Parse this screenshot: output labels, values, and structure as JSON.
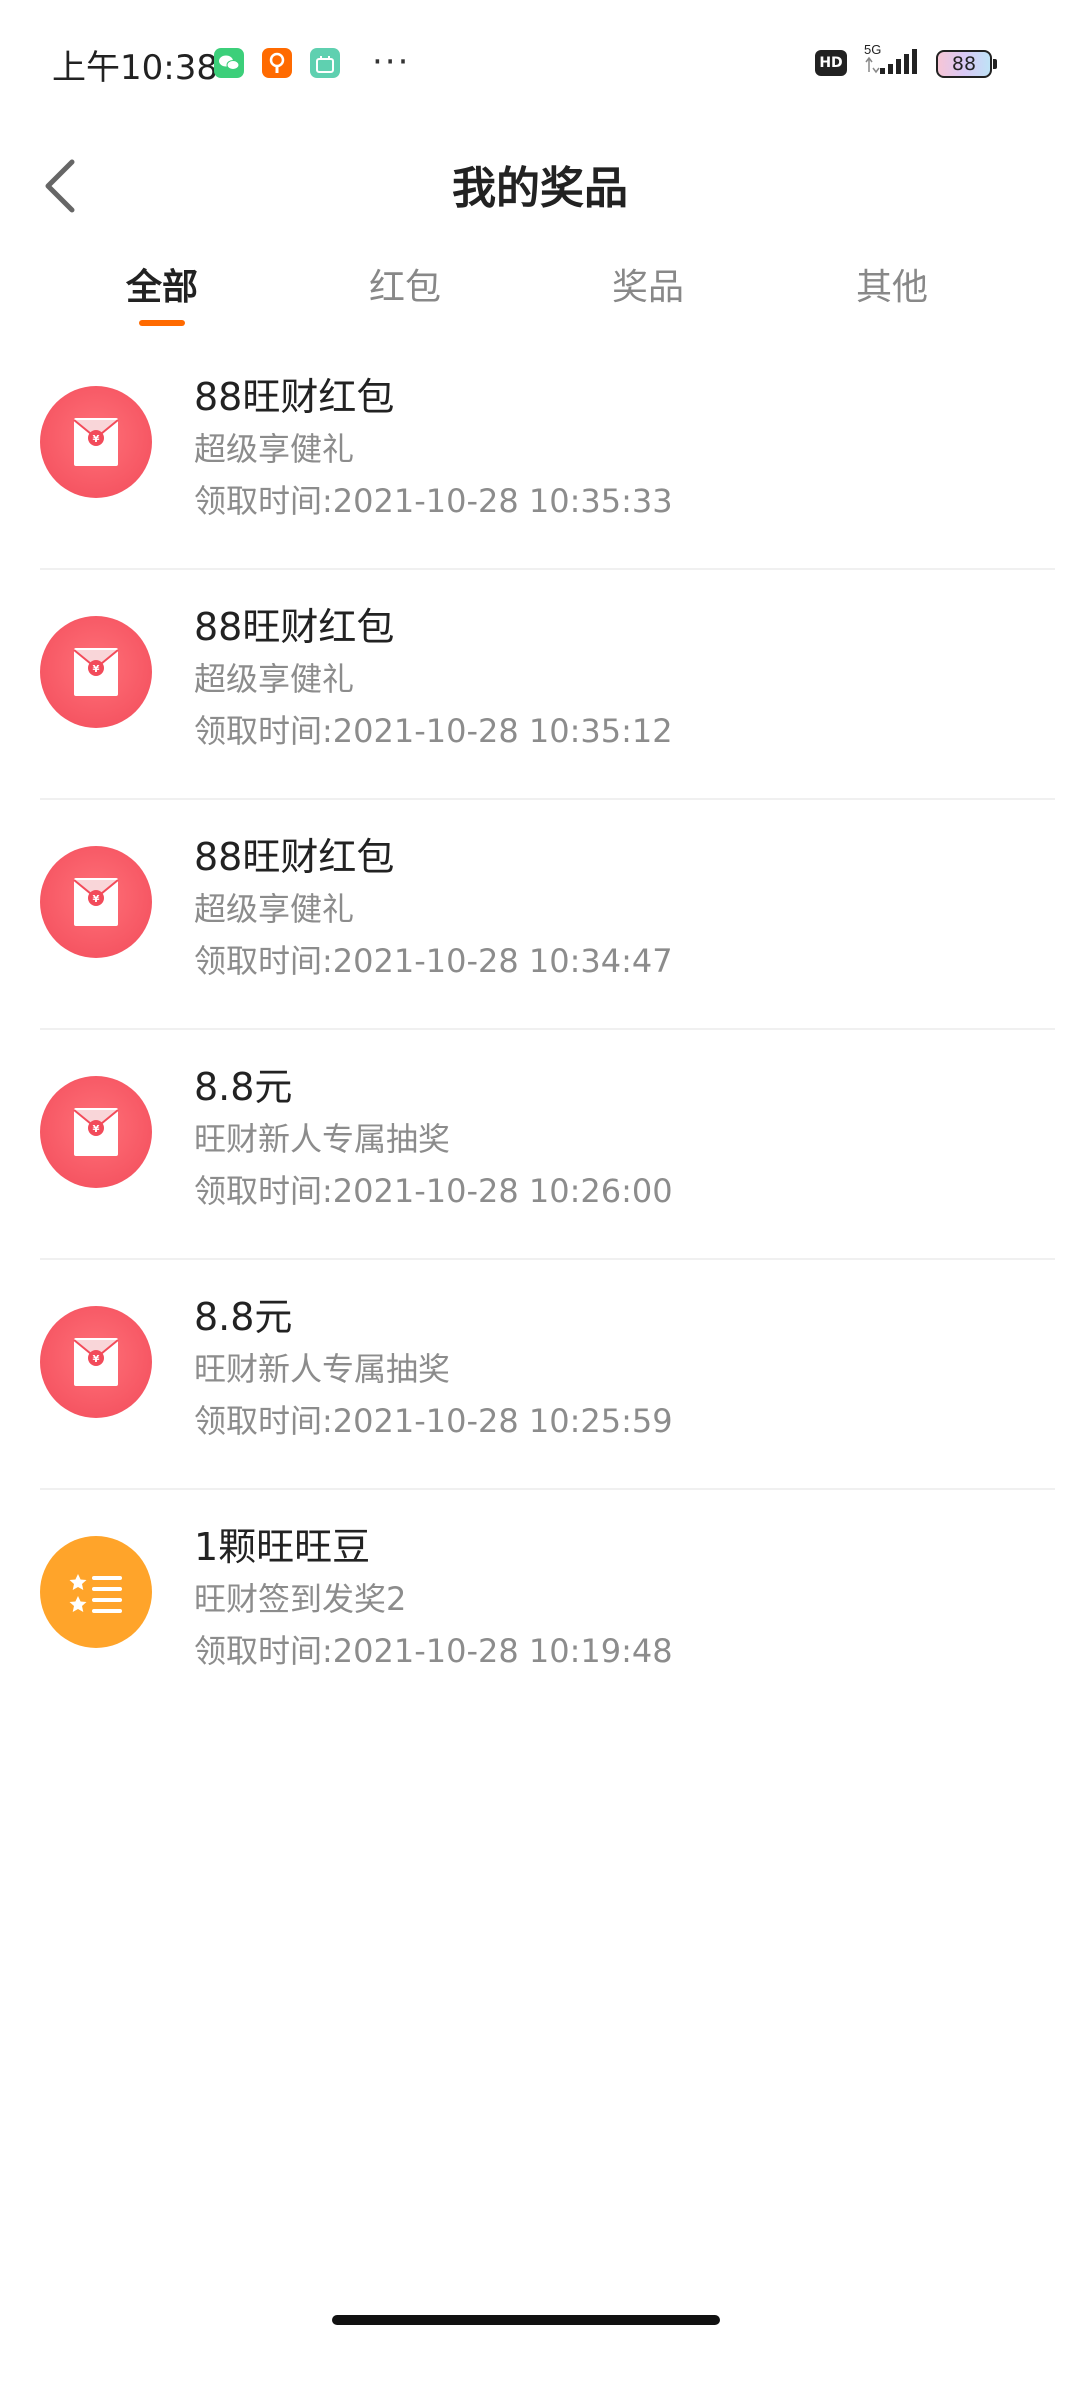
{
  "status_bar": {
    "time": "上午10:38",
    "more_dots": "···",
    "hd_label": "HD",
    "network": "5G",
    "battery": "88"
  },
  "header": {
    "title": "我的奖品"
  },
  "tabs": [
    {
      "label": "全部",
      "active": true
    },
    {
      "label": "红包",
      "active": false
    },
    {
      "label": "奖品",
      "active": false
    },
    {
      "label": "其他",
      "active": false
    }
  ],
  "accent_color": "#ff6a00",
  "items": [
    {
      "icon": "red-envelope-icon",
      "title": "88旺财红包",
      "subtitle": "超级享健礼",
      "time": "领取时间:2021-10-28 10:35:33"
    },
    {
      "icon": "red-envelope-icon",
      "title": "88旺财红包",
      "subtitle": "超级享健礼",
      "time": "领取时间:2021-10-28 10:35:12"
    },
    {
      "icon": "red-envelope-icon",
      "title": "88旺财红包",
      "subtitle": "超级享健礼",
      "time": "领取时间:2021-10-28 10:34:47"
    },
    {
      "icon": "red-envelope-icon",
      "title": "8.8元",
      "subtitle": "旺财新人专属抽奖",
      "time": "领取时间:2021-10-28 10:26:00"
    },
    {
      "icon": "red-envelope-icon",
      "title": "8.8元",
      "subtitle": "旺财新人专属抽奖",
      "time": "领取时间:2021-10-28 10:25:59"
    },
    {
      "icon": "star-list-icon",
      "title": "1颗旺旺豆",
      "subtitle": "旺财签到发奖2",
      "time": "领取时间:2021-10-28 10:19:48"
    }
  ]
}
